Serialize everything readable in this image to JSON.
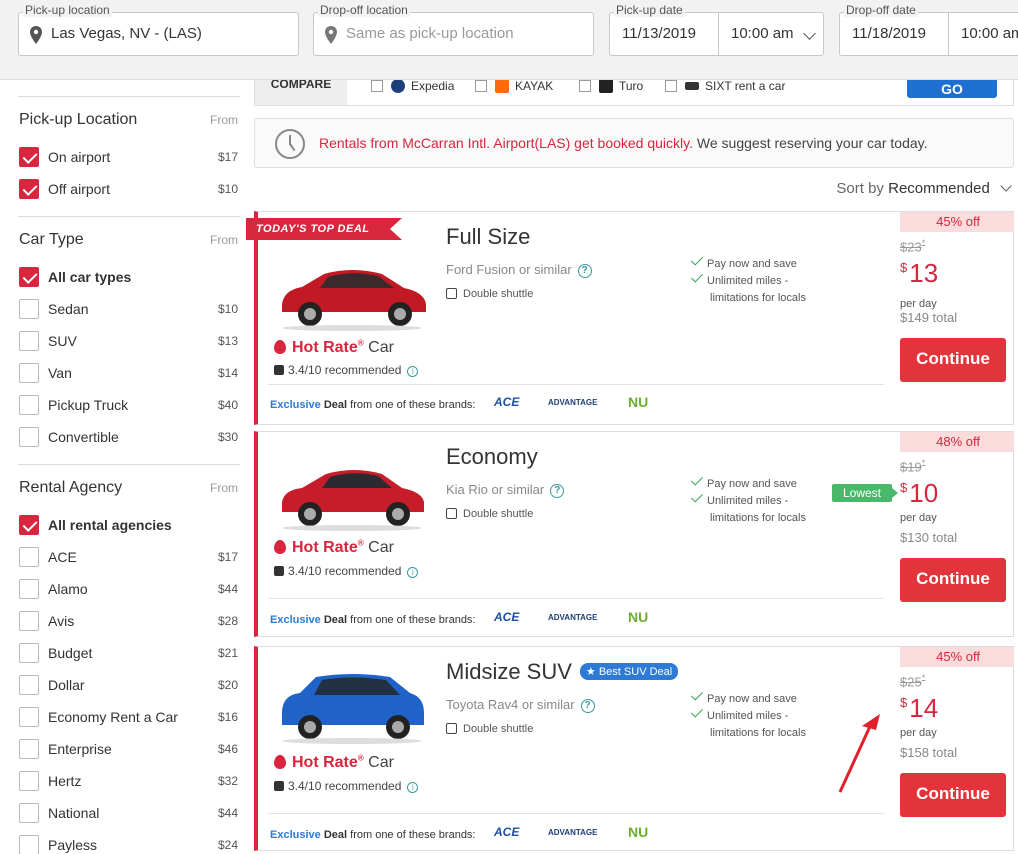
{
  "search": {
    "pickup_location_label": "Pick-up location",
    "pickup_location_value": "Las Vegas, NV - (LAS)",
    "dropoff_location_label": "Drop-off location",
    "dropoff_location_placeholder": "Same as pick-up location",
    "pickup_date_label": "Pick-up date",
    "pickup_date_value": "11/13/2019",
    "pickup_time_value": "10:00 am",
    "dropoff_date_label": "Drop-off date",
    "dropoff_date_value": "11/18/2019",
    "dropoff_time_value": "10:00 am"
  },
  "filters": {
    "from_label": "From",
    "pickup": {
      "title": "Pick-up Location",
      "items": [
        {
          "label": "On airport",
          "price": "$17",
          "checked": true
        },
        {
          "label": "Off airport",
          "price": "$10",
          "checked": true
        }
      ]
    },
    "car_type": {
      "title": "Car Type",
      "items": [
        {
          "label": "All car types",
          "price": "",
          "checked": true
        },
        {
          "label": "Sedan",
          "price": "$10",
          "checked": false
        },
        {
          "label": "SUV",
          "price": "$13",
          "checked": false
        },
        {
          "label": "Van",
          "price": "$14",
          "checked": false
        },
        {
          "label": "Pickup Truck",
          "price": "$40",
          "checked": false
        },
        {
          "label": "Convertible",
          "price": "$30",
          "checked": false
        }
      ]
    },
    "agency": {
      "title": "Rental Agency",
      "items": [
        {
          "label": "All rental agencies",
          "price": "",
          "checked": true
        },
        {
          "label": "ACE",
          "price": "$17",
          "checked": false
        },
        {
          "label": "Alamo",
          "price": "$44",
          "checked": false
        },
        {
          "label": "Avis",
          "price": "$28",
          "checked": false
        },
        {
          "label": "Budget",
          "price": "$21",
          "checked": false
        },
        {
          "label": "Dollar",
          "price": "$20",
          "checked": false
        },
        {
          "label": "Economy Rent a Car",
          "price": "$16",
          "checked": false
        },
        {
          "label": "Enterprise",
          "price": "$46",
          "checked": false
        },
        {
          "label": "Hertz",
          "price": "$32",
          "checked": false
        },
        {
          "label": "National",
          "price": "$44",
          "checked": false
        },
        {
          "label": "Payless",
          "price": "$24",
          "checked": false
        }
      ]
    }
  },
  "compare": {
    "label": "COMPARE",
    "sites": [
      {
        "name": "Expedia",
        "color": "#1f3f7a"
      },
      {
        "name": "KAYAK",
        "color": "#ff690f"
      },
      {
        "name": "Turo",
        "color": "#222222"
      },
      {
        "name": "SIXT rent a car",
        "color": "#333333"
      }
    ],
    "go_label": "GO"
  },
  "notice": {
    "red_text": "Rentals from McCarran Intl. Airport(LAS) get booked quickly.",
    "gray_text": "We suggest reserving your car today."
  },
  "sort": {
    "label": "Sort by",
    "value": "Recommended"
  },
  "results": [
    {
      "ribbon": "TODAY'S TOP DEAL",
      "title": "Full Size",
      "badge": "",
      "model": "Ford Fusion or similar",
      "shuttle": "Double shuttle",
      "feature1": "Pay now and save",
      "feature2": "Unlimited miles -",
      "feature3": "limitations for locals",
      "hot_rate": "Hot Rate",
      "hot_car": "Car",
      "recommended": "3.4/10 recommended",
      "exclusive": "Exclusive",
      "deal": "Deal",
      "deal_text": "from one of these brands:",
      "off": "45% off",
      "old_price": "$23",
      "currency": "$",
      "price": "13",
      "per_day": "per day",
      "total": "$149 total",
      "lowest": "",
      "button": "Continue",
      "car_color": "#c21a25"
    },
    {
      "ribbon": "",
      "title": "Economy",
      "badge": "",
      "model": "Kia Rio or similar",
      "shuttle": "Double shuttle",
      "feature1": "Pay now and save",
      "feature2": "Unlimited miles -",
      "feature3": "limitations for locals",
      "hot_rate": "Hot Rate",
      "hot_car": "Car",
      "recommended": "3.4/10 recommended",
      "exclusive": "Exclusive",
      "deal": "Deal",
      "deal_text": "from one of these brands:",
      "off": "48% off",
      "old_price": "$19",
      "currency": "$",
      "price": "10",
      "per_day": "per day",
      "total": "$130 total",
      "lowest": "Lowest",
      "button": "Continue",
      "car_color": "#c71d2a"
    },
    {
      "ribbon": "",
      "title": "Midsize SUV",
      "badge": "Best SUV Deal",
      "model": "Toyota Rav4 or similar",
      "shuttle": "Double shuttle",
      "feature1": "Pay now and save",
      "feature2": "Unlimited miles -",
      "feature3": "limitations for locals",
      "hot_rate": "Hot Rate",
      "hot_car": "Car",
      "recommended": "3.4/10 recommended",
      "exclusive": "Exclusive",
      "deal": "Deal",
      "deal_text": "from one of these brands:",
      "off": "45% off",
      "old_price": "$25",
      "currency": "$",
      "price": "14",
      "per_day": "per day",
      "total": "$158 total",
      "lowest": "",
      "button": "Continue",
      "car_color": "#1f63c8"
    }
  ],
  "brands": {
    "ace": "ACE",
    "advantage": "ADVANTAGE",
    "nu": "NU"
  },
  "colors": {
    "accent_red": "#d7263d",
    "button_red": "#e3343c",
    "go_blue": "#1f6fd1",
    "lowest_green": "#4ab86a"
  }
}
